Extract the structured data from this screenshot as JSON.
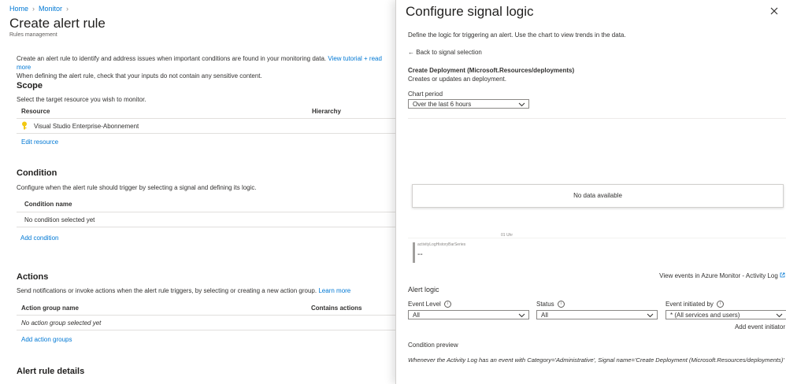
{
  "breadcrumb": {
    "home": "Home",
    "monitor": "Monitor"
  },
  "page": {
    "title": "Create alert rule",
    "subtitle": "Rules management"
  },
  "intro": {
    "line1": "Create an alert rule to identify and address issues when important conditions are found in your monitoring data.",
    "tutorial_link": "View tutorial + read more",
    "line2": "When defining the alert rule, check that your inputs do not contain any sensitive content."
  },
  "scope": {
    "heading": "Scope",
    "description": "Select the target resource you wish to monitor.",
    "col_resource": "Resource",
    "col_hierarchy": "Hierarchy",
    "resource_name": "Visual Studio Enterprise-Abonnement",
    "edit_link": "Edit resource"
  },
  "condition": {
    "heading": "Condition",
    "description": "Configure when the alert rule should trigger by selecting a signal and defining its logic.",
    "col_name": "Condition name",
    "empty": "No condition selected yet",
    "add_link": "Add condition"
  },
  "actions": {
    "heading": "Actions",
    "description": "Send notifications or invoke actions when the alert rule triggers, by selecting or creating a new action group.",
    "learn_more": "Learn more",
    "col_group": "Action group name",
    "col_contains": "Contains actions",
    "empty": "No action group selected yet",
    "add_link": "Add action groups"
  },
  "details": {
    "heading": "Alert rule details"
  },
  "panel": {
    "title": "Configure signal logic",
    "description": "Define the logic for triggering an alert. Use the chart to view trends in the data.",
    "back_link": "Back to signal selection",
    "signal_name": "Create Deployment (Microsoft.Resources/deployments)",
    "signal_desc": "Creates or updates an deployment.",
    "chart_period_label": "Chart period",
    "chart_period_value": "Over the last 6 hours",
    "no_data": "No data available",
    "time_tick": "01 Uhr",
    "series_label": "activityLogHistoryBarSeries",
    "series_value": "--",
    "view_events_link": "View events in Azure Monitor - Activity Log",
    "alert_logic_heading": "Alert logic",
    "event_level_label": "Event Level",
    "event_level_value": "All",
    "status_label": "Status",
    "status_value": "All",
    "initiated_by_label": "Event initiated by",
    "initiated_by_value": "* (All services and users)",
    "add_initiator_link": "Add event initiator",
    "condition_preview_label": "Condition preview",
    "condition_preview_text": "Whenever the Activity Log has an event with Category='Administrative', Signal name='Create Deployment (Microsoft.Resources/deployments)'"
  },
  "colors": {
    "accent": "#0078d4",
    "key_icon": "#f2c811",
    "series_bar": "#a19f9d"
  }
}
